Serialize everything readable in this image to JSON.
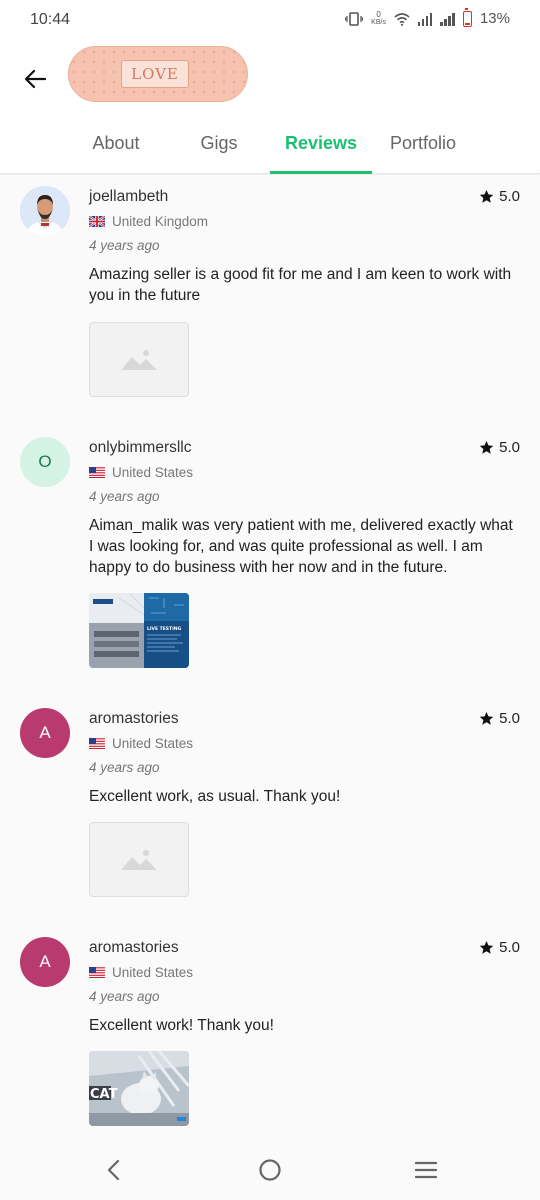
{
  "status_bar": {
    "time": "10:44",
    "net_speed_value": "0",
    "net_speed_unit": "KB/s",
    "battery": "13%"
  },
  "header": {
    "badge_text": "LOVE",
    "back_icon": "arrow-left-icon"
  },
  "tabs": [
    {
      "label": "About",
      "active": false
    },
    {
      "label": "Gigs",
      "active": false
    },
    {
      "label": "Reviews",
      "active": true
    },
    {
      "label": "Portfolio",
      "active": false
    }
  ],
  "colors": {
    "accent": "#1dbf73",
    "avatar_mint_bg": "#d4f3e5",
    "avatar_mint_fg": "#1a7a4c",
    "avatar_maroon": "#b83a6e"
  },
  "reviews": [
    {
      "username": "joellambeth",
      "rating": "5.0",
      "country": "United Kingdom",
      "time": "4 years ago",
      "text": "Amazing seller is a good fit for me and I am keen to work with you in the future",
      "avatar_initial": "",
      "attachment": "image-placeholder"
    },
    {
      "username": "onlybimmersllc",
      "rating": "5.0",
      "country": "United States",
      "time": "4 years ago",
      "text": "Aiman_malik was very patient with me, delivered exactly what I was looking for, and was quite professional as well. I am happy to do business with her now and in the future.",
      "avatar_initial": "O",
      "attachment": "live-testing-screenshot",
      "attachment_caption": "LIVE TESTING"
    },
    {
      "username": "aromastories",
      "rating": "5.0",
      "country": "United States",
      "time": "4 years ago",
      "text": "Excellent work, as usual. Thank you!",
      "avatar_initial": "A",
      "attachment": "image-placeholder"
    },
    {
      "username": "aromastories",
      "rating": "5.0",
      "country": "United States",
      "time": "4 years ago",
      "text": "Excellent work! Thank you!",
      "avatar_initial": "A",
      "attachment": "cat-website-screenshot",
      "attachment_caption": "CAT"
    }
  ],
  "nav_bar": {
    "back": "chevron-left-icon",
    "home": "circle-home-icon",
    "menu": "hamburger-menu-icon"
  }
}
